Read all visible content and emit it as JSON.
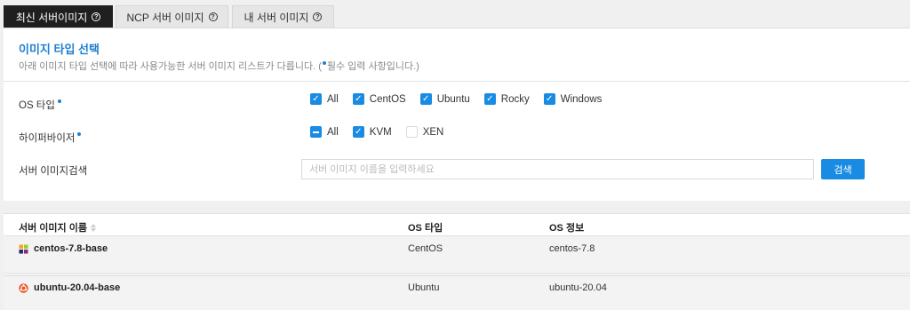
{
  "tabs": [
    {
      "label": "최신 서버이미지",
      "active": true,
      "icon": "help-icon"
    },
    {
      "label": "NCP 서버 이미지",
      "active": false,
      "icon": "help-icon"
    },
    {
      "label": "내 서버 이미지",
      "active": false,
      "icon": "help-icon"
    }
  ],
  "panel": {
    "title": "이미지 타입 선택",
    "description_before": "아래 이미지 타입 선택에 따라 사용가능한 서버 이미지 리스트가 다릅니다. (",
    "description_after": "필수 입력 사항입니다.)"
  },
  "os_type": {
    "label": "OS 타입",
    "options": [
      {
        "label": "All",
        "state": "checked"
      },
      {
        "label": "CentOS",
        "state": "checked"
      },
      {
        "label": "Ubuntu",
        "state": "checked"
      },
      {
        "label": "Rocky",
        "state": "checked"
      },
      {
        "label": "Windows",
        "state": "checked"
      }
    ]
  },
  "hypervisor": {
    "label": "하이퍼바이저",
    "options": [
      {
        "label": "All",
        "state": "partial"
      },
      {
        "label": "KVM",
        "state": "checked"
      },
      {
        "label": "XEN",
        "state": "unchecked"
      }
    ]
  },
  "search": {
    "label": "서버 이미지검색",
    "placeholder": "서버 이미지 이름을 입력하세요",
    "value": "",
    "button_label": "검색"
  },
  "table": {
    "headers": {
      "name": "서버 이미지 이름",
      "os_type": "OS 타입",
      "os_info": "OS 정보"
    },
    "rows": [
      {
        "name": "centos-7.8-base",
        "os_type": "CentOS",
        "os_info": "centos-7.8",
        "icon": "centos-icon"
      },
      {
        "name": "ubuntu-20.04-base",
        "os_type": "Ubuntu",
        "os_info": "ubuntu-20.04",
        "icon": "ubuntu-icon"
      }
    ]
  },
  "colors": {
    "accent": "#1a8be3",
    "title_blue": "#1f7fd1",
    "active_tab": "#1f1f1f"
  }
}
